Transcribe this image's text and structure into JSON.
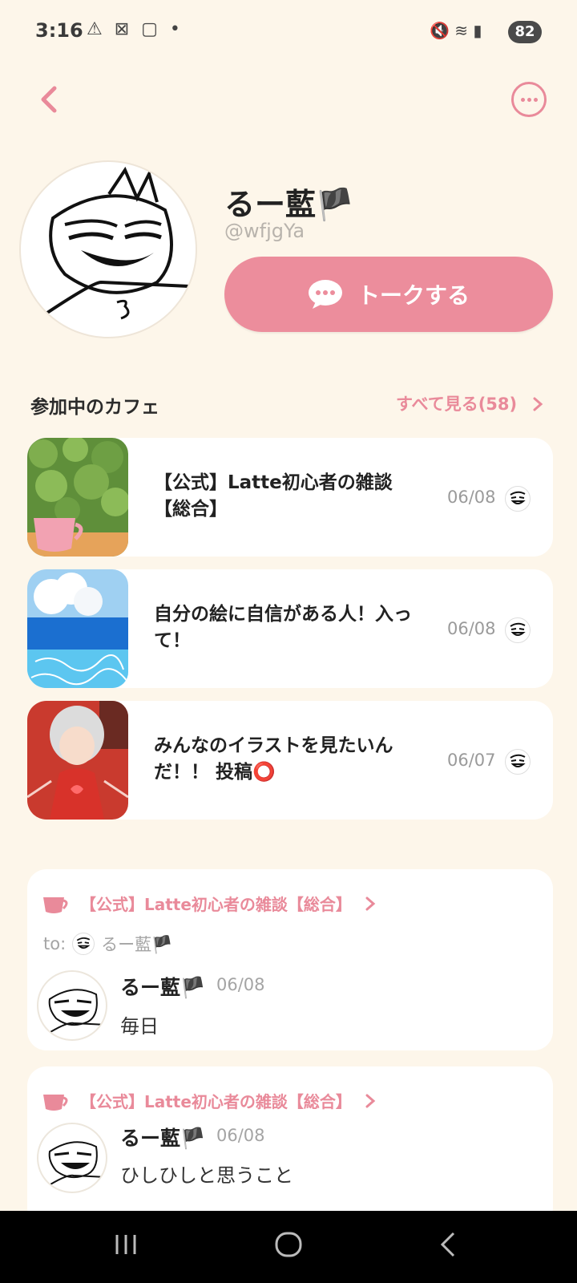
{
  "status": {
    "time": "3:16",
    "left_icons": "⚠ ⊠ ▢ •",
    "right_icons": "🔇 ≋ ▮",
    "battery": "82"
  },
  "profile": {
    "username": "るー藍🏴",
    "handle": "@wfjgYa",
    "talk_label": "トークする"
  },
  "cafes_section": {
    "title": "参加中のカフェ",
    "see_all": "すべて見る(58)",
    "items": [
      {
        "name": "【公式】Latte初心者の雑談【総合】",
        "date": "06/08"
      },
      {
        "name": "自分の絵に自信がある人！入って！",
        "date": "06/08"
      },
      {
        "name": "みんなのイラストを見たいんだ！！ 投稿⭕",
        "date": "06/07"
      }
    ]
  },
  "posts": [
    {
      "cafe": "【公式】Latte初心者の雑談【総合】",
      "to_label": "to:",
      "to_user": "るー藍🏴",
      "author": "るー藍🏴",
      "date": "06/08",
      "text": "毎日"
    },
    {
      "cafe": "【公式】Latte初心者の雑談【総合】",
      "author": "るー藍🏴",
      "date": "06/08",
      "text": "ひしひしと思うこと"
    }
  ],
  "colors": {
    "background": "#fdf6ea",
    "accent": "#ec8d9c",
    "nav": "#000000"
  },
  "icons": {
    "back": "chevron-left-icon",
    "more": "more-dots-icon",
    "chat": "chat-bubble-icon",
    "cafe": "cup-icon",
    "chevron": "chevron-right-icon"
  }
}
